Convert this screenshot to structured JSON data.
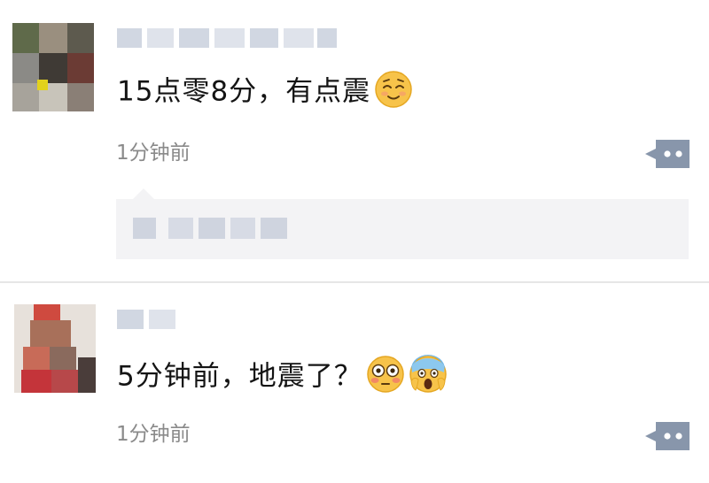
{
  "posts": [
    {
      "message": "15点零8分，有点震",
      "emojis": [
        "relieved-face-emoji"
      ],
      "time": "1分钟前",
      "has_likes": true
    },
    {
      "message": "5分钟前，地震了？",
      "emojis": [
        "flushed-face-emoji",
        "screaming-face-emoji"
      ],
      "time": "1分钟前",
      "has_likes": false
    }
  ],
  "colors": {
    "text": "#141414",
    "time": "#8a8a8a",
    "comment_button": "#8896ab",
    "like_box": "#f3f3f5",
    "divider": "#e6e6e6"
  }
}
